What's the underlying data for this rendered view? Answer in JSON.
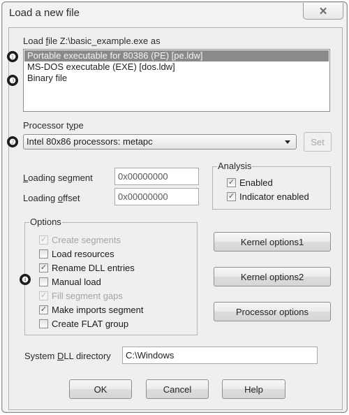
{
  "window": {
    "title": "Load a new file",
    "close_icon": "close-x-icon"
  },
  "load_file": {
    "label_pre": "Load ",
    "label_accel": "f",
    "label_post": "ile Z:\\basic_example.exe as",
    "formats": [
      {
        "label": "Portable executable for 80386 (PE) [pe.ldw]",
        "selected": true,
        "marker": "❶"
      },
      {
        "label": "MS-DOS executable (EXE) [dos.ldw]",
        "selected": false,
        "marker": ""
      },
      {
        "label": "Binary file",
        "selected": false,
        "marker": "❸"
      }
    ]
  },
  "processor": {
    "label_pre": "Processor t",
    "label_accel": "y",
    "label_post": "pe",
    "selected": "Intel 80x86 processors: metapc",
    "marker": "❷",
    "set_label": "Set"
  },
  "loading": {
    "segment_accel": "L",
    "segment_rest": "oading segment",
    "segment_value": "0x00000000",
    "offset_pre": "Loading ",
    "offset_accel": "o",
    "offset_post": "ffset",
    "offset_value": "0x00000000"
  },
  "analysis": {
    "title": "Analysis",
    "items": [
      {
        "label": "Enabled",
        "checked": true
      },
      {
        "label": "Indicator enabled",
        "checked": true
      }
    ]
  },
  "options": {
    "title": "Options",
    "marker": "❹",
    "items": [
      {
        "label": "Create segments",
        "checked": true,
        "disabled": true
      },
      {
        "label": "Load resources",
        "checked": false,
        "disabled": false
      },
      {
        "label": "Rename DLL entries",
        "checked": true,
        "disabled": false
      },
      {
        "label": "Manual load",
        "checked": false,
        "disabled": false
      },
      {
        "label": "Fill segment gaps",
        "checked": true,
        "disabled": true
      },
      {
        "label": "Make imports segment",
        "checked": true,
        "disabled": false
      },
      {
        "label": "Create FLAT group",
        "checked": false,
        "disabled": false
      }
    ]
  },
  "side_buttons": {
    "kernel1": "Kernel options1",
    "kernel2": "Kernel options2",
    "processor": "Processor options"
  },
  "dll_dir": {
    "label_pre": "System ",
    "label_accel": "D",
    "label_post": "LL directory",
    "value": "C:\\Windows"
  },
  "footer": {
    "ok": "OK",
    "cancel": "Cancel",
    "help": "Help"
  }
}
